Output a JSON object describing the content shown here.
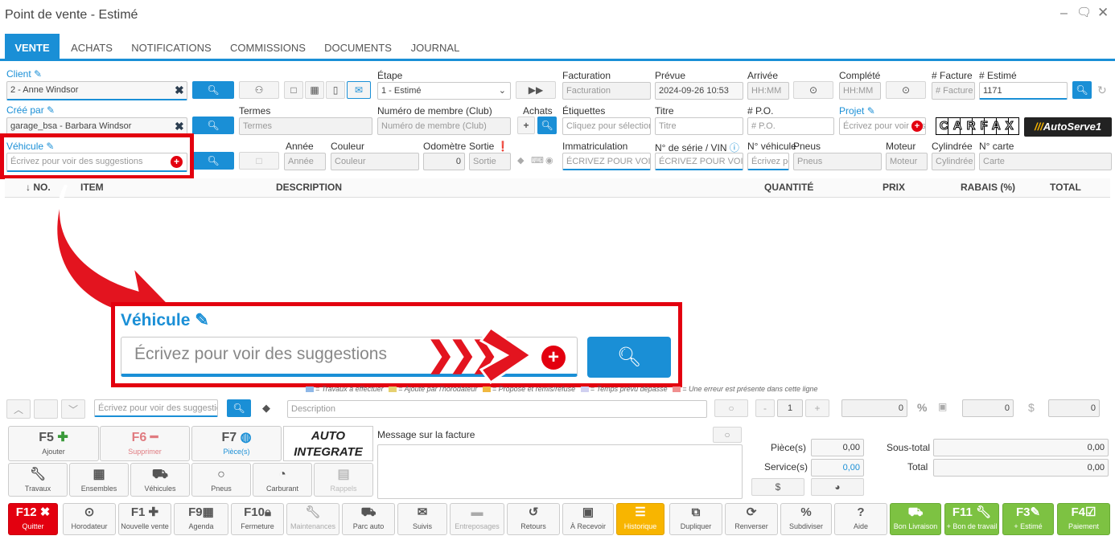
{
  "window": {
    "title": "Point de vente - Estimé"
  },
  "tabs": [
    "VENTE",
    "ACHATS",
    "NOTIFICATIONS",
    "COMMISSIONS",
    "DOCUMENTS",
    "JOURNAL"
  ],
  "labels": {
    "client": "Client",
    "cree_par": "Créé par",
    "vehicule": "Véhicule",
    "etape": "Étape",
    "termes": "Termes",
    "numero_membre": "Numéro de membre (Club)",
    "achats": "Achats",
    "etiquettes": "Étiquettes",
    "facturation": "Facturation",
    "prevue": "Prévue",
    "arrivee": "Arrivée",
    "complete": "Complété",
    "facture": "# Facture",
    "estime": "# Estimé",
    "titre": "Titre",
    "po": "# P.O.",
    "projet": "Projet",
    "annee": "Année",
    "couleur": "Couleur",
    "odometre": "Odomètre",
    "sortie": "Sortie",
    "immatriculation": "Immatriculation",
    "vin": "N° de série / VIN",
    "no_vehicule": "N° véhicule",
    "pneus": "Pneus",
    "moteur": "Moteur",
    "cylindree": "Cylindrée",
    "no_carte": "N° carte"
  },
  "fields": {
    "client": "2 - Anne Windsor",
    "cree_par": "garage_bsa - Barbara Windsor",
    "etape": "1 - Estimé",
    "prevue": "2024-09-26 10:53",
    "estime": "1171",
    "odometre": "0"
  },
  "placeholders": {
    "vehicule": "Écrivez pour voir des suggestions",
    "termes": "Termes",
    "numero_membre": "Numéro de membre (Club)",
    "etiquettes": "Cliquez pour sélectionner",
    "facturation": "Facturation",
    "arrivee": "HH:MM",
    "complete": "HH:MM",
    "facture": "# Facture",
    "titre": "Titre",
    "po": "# P.O.",
    "projet": "Écrivez pour voir des suggestions",
    "annee": "Année",
    "couleur": "Couleur",
    "sortie": "Sortie",
    "immatriculation": "ÉCRIVEZ POUR VOIR DES SUGGESTIONS",
    "vin": "ÉCRIVEZ POUR VOIR DES SUGGESTIONS",
    "no_vehicule": "Écrivez pour voir",
    "pneus": "Pneus",
    "moteur": "Moteur",
    "cylindree": "Cylindrée",
    "carte": "Carte",
    "item_search": "Écrivez pour voir des suggestions",
    "description": "Description"
  },
  "logos": {
    "carfax": "CARFAX",
    "autoserve": "AutoServe1",
    "autointegrate": "AUTO INTEGRATE"
  },
  "table_headers": {
    "no": "↓ NO.",
    "item": "ITEM",
    "description": "DESCRIPTION",
    "quantite": "QUANTITÉ",
    "prix": "PRIX",
    "rabais": "RABAIS (%)",
    "total": "TOTAL"
  },
  "zoom": {
    "label": "Véhicule",
    "placeholder": "Écrivez pour voir des suggestions"
  },
  "legend": [
    "= Travaux à effectuer",
    "= Ajouté par l'horodateur",
    "= Proposé et remis/refusé",
    "= Temps prévu dépassé",
    "= Une erreur est présente dans cette ligne"
  ],
  "entry": {
    "qty": "1",
    "val1": "0",
    "val2": "0",
    "val3": "0"
  },
  "quick": [
    {
      "k": "F5",
      "s": "Ajouter"
    },
    {
      "k": "F6",
      "s": "Supprimer"
    },
    {
      "k": "F7",
      "s": "Pièce(s)"
    }
  ],
  "quick2": [
    "Travaux",
    "Ensembles",
    "Véhicules",
    "Pneus",
    "Carburant",
    "Rappels"
  ],
  "message_label": "Message sur la facture",
  "totals": {
    "pieces_label": "Pièce(s)",
    "pieces": "0,00",
    "service_label": "Service(s)",
    "service": "0,00",
    "sous_total_label": "Sous-total",
    "sous_total": "0,00",
    "total_label": "Total",
    "total": "0,00"
  },
  "fkeys": [
    {
      "k": "F12",
      "s": "Quitter"
    },
    {
      "k": "",
      "s": "Horodateur"
    },
    {
      "k": "F1",
      "s": "Nouvelle vente"
    },
    {
      "k": "F9",
      "s": "Agenda"
    },
    {
      "k": "F10",
      "s": "Fermeture"
    },
    {
      "k": "",
      "s": "Maintenances"
    },
    {
      "k": "",
      "s": "Parc auto"
    },
    {
      "k": "",
      "s": "Suivis"
    },
    {
      "k": "",
      "s": "Entreposages"
    },
    {
      "k": "",
      "s": "Retours"
    },
    {
      "k": "",
      "s": "À Recevoir"
    },
    {
      "k": "",
      "s": "Historique"
    },
    {
      "k": "",
      "s": "Dupliquer"
    },
    {
      "k": "",
      "s": "Renverser"
    },
    {
      "k": "",
      "s": "Subdiviser"
    },
    {
      "k": "?",
      "s": "Aide"
    },
    {
      "k": "",
      "s": "Bon Livraison"
    },
    {
      "k": "F11",
      "s": "+ Bon de travail"
    },
    {
      "k": "F3",
      "s": "+ Estimé"
    },
    {
      "k": "F4",
      "s": "Paiement"
    }
  ],
  "colors": {
    "accent": "#1a8fd6",
    "highlight": "#e3000f",
    "green": "#7dc242",
    "orange": "#f8b500"
  }
}
